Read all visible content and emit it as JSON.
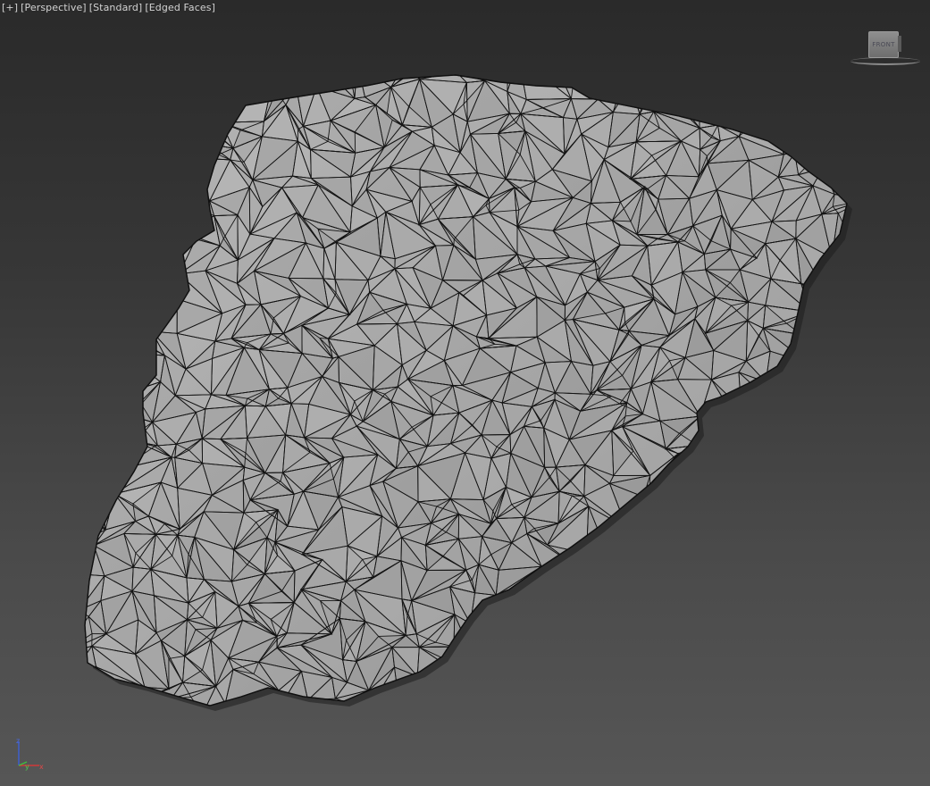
{
  "viewport": {
    "menu": "[+]",
    "view": "[Perspective]",
    "shading": "[Standard]",
    "display": "[Edged Faces]"
  },
  "viewcube": {
    "face": "FRONT"
  },
  "axis": {
    "x": "x",
    "y": "y",
    "z": "z"
  },
  "colors": {
    "background_top": "#2a2a2a",
    "background_bottom": "#565656",
    "mesh_fill": "#a4a4a4",
    "wireframe": "#111111"
  },
  "icons": [
    "viewcube-icon",
    "axis-tripod-icon"
  ]
}
